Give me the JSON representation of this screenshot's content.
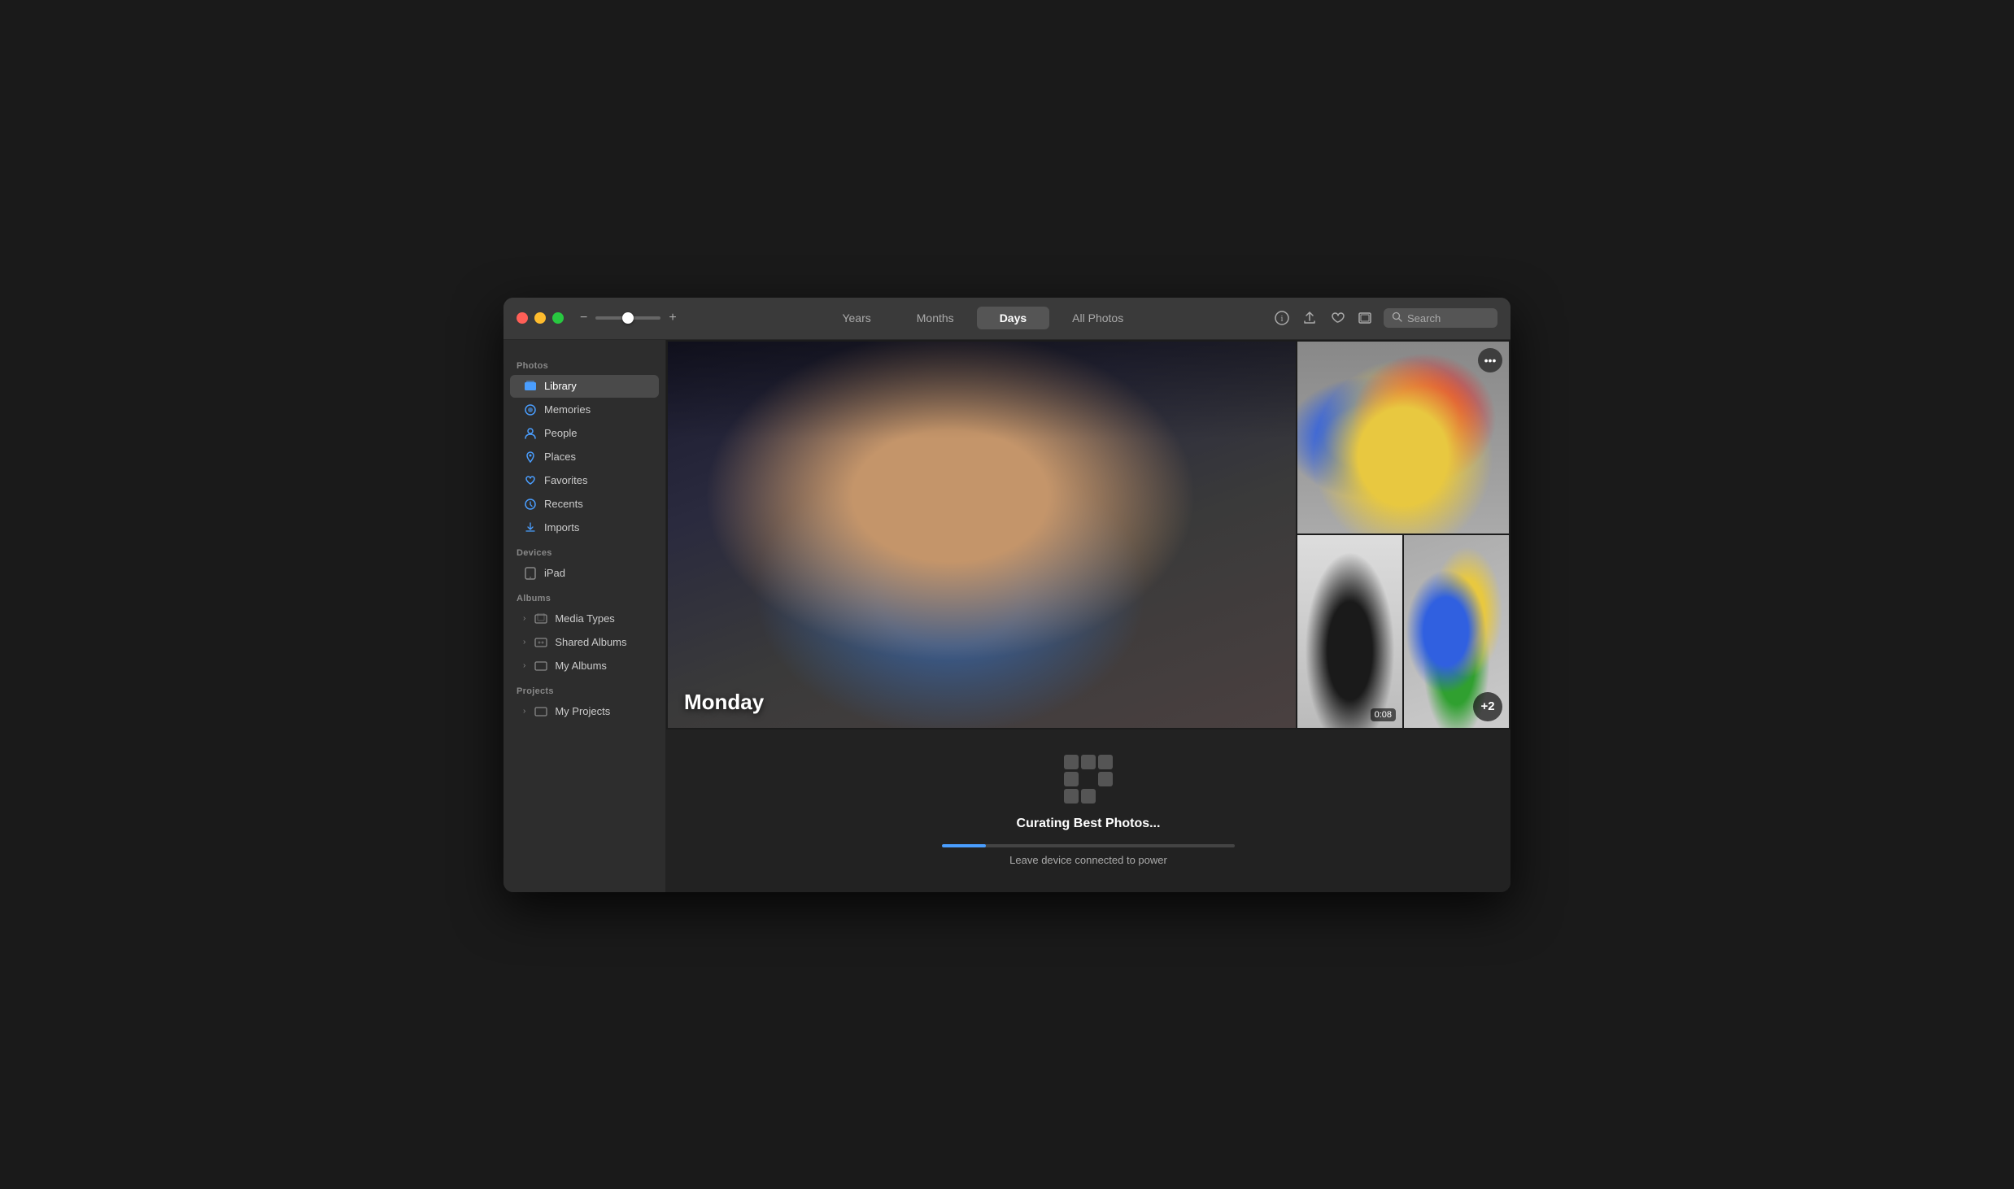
{
  "window": {
    "title": "Photos"
  },
  "titlebar": {
    "traffic_lights": {
      "close_label": "close",
      "minimize_label": "minimize",
      "maximize_label": "maximize"
    },
    "zoom": {
      "minus_label": "−",
      "plus_label": "+"
    },
    "tabs": [
      {
        "id": "years",
        "label": "Years",
        "active": false
      },
      {
        "id": "months",
        "label": "Months",
        "active": false
      },
      {
        "id": "days",
        "label": "Days",
        "active": true
      },
      {
        "id": "all-photos",
        "label": "All Photos",
        "active": false
      }
    ],
    "actions": {
      "info_icon": "ℹ",
      "share_icon": "⬆",
      "favorites_icon": "♡",
      "slideshow_icon": "⬜"
    },
    "search": {
      "placeholder": "Search",
      "icon": "🔍"
    }
  },
  "sidebar": {
    "photos_section": {
      "label": "Photos",
      "items": [
        {
          "id": "library",
          "label": "Library",
          "icon": "photos",
          "active": true
        },
        {
          "id": "memories",
          "label": "Memories",
          "icon": "memories"
        },
        {
          "id": "people",
          "label": "People",
          "icon": "people"
        },
        {
          "id": "places",
          "label": "Places",
          "icon": "places"
        },
        {
          "id": "favorites",
          "label": "Favorites",
          "icon": "favorites"
        },
        {
          "id": "recents",
          "label": "Recents",
          "icon": "recents"
        },
        {
          "id": "imports",
          "label": "Imports",
          "icon": "imports"
        }
      ]
    },
    "devices_section": {
      "label": "Devices",
      "items": [
        {
          "id": "ipad",
          "label": "iPad",
          "icon": "ipad"
        }
      ]
    },
    "albums_section": {
      "label": "Albums",
      "items": [
        {
          "id": "media-types",
          "label": "Media Types",
          "icon": "folder",
          "has_chevron": true
        },
        {
          "id": "shared-albums",
          "label": "Shared Albums",
          "icon": "shared-folder",
          "has_chevron": true
        },
        {
          "id": "my-albums",
          "label": "My Albums",
          "icon": "folder",
          "has_chevron": true
        }
      ]
    },
    "projects_section": {
      "label": "Projects",
      "items": [
        {
          "id": "my-projects",
          "label": "My Projects",
          "icon": "folder",
          "has_chevron": true
        }
      ]
    }
  },
  "main": {
    "day_label": "Monday",
    "photos": [
      {
        "id": "girl-laptop",
        "type": "main",
        "alt": "Girl with laptop eating cereal"
      },
      {
        "id": "lego-blocks",
        "type": "thumb-top",
        "alt": "Colorful LEGO blocks",
        "has_ellipsis": true,
        "ellipsis_label": "•••"
      },
      {
        "id": "remote-video",
        "type": "thumb-bottom-left",
        "alt": "Hand holding remote",
        "video_duration": "0:08"
      },
      {
        "id": "lego-figure",
        "type": "thumb-bottom-right",
        "alt": "LEGO figure",
        "has_more": true,
        "more_count": "+2"
      }
    ],
    "curation": {
      "title": "Curating Best Photos...",
      "subtitle": "Leave device connected to power",
      "progress_percent": 15,
      "icon_cells": [
        true,
        true,
        true,
        true,
        false,
        true,
        true,
        true,
        false
      ]
    }
  }
}
